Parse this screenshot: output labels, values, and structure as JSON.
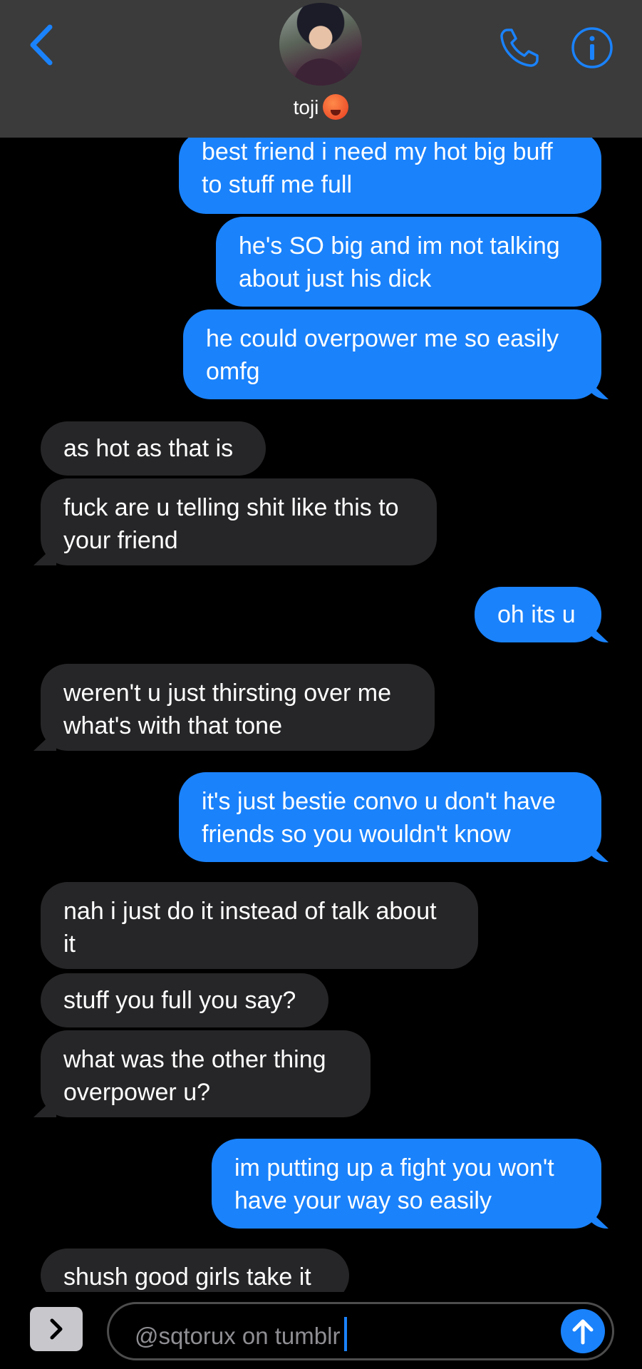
{
  "header": {
    "contact_name": "toji",
    "contact_emoji": "hot-face-emoji",
    "back_icon": "chevron-left-icon",
    "call_icon": "phone-icon",
    "info_icon": "info-icon",
    "accent": "#1a82fb"
  },
  "messages": [
    {
      "from": "me",
      "text": "best friend i need my hot big buff\nto stuff me full"
    },
    {
      "from": "me",
      "text": "he's SO big and im not talking\nabout just his dick"
    },
    {
      "from": "me",
      "text": "he could overpower me so easily\nomfg"
    },
    {
      "from": "them",
      "text": "as hot as that is"
    },
    {
      "from": "them",
      "text": "fuck are u telling shit like this to\nyour friend"
    },
    {
      "from": "me",
      "text": "oh its u"
    },
    {
      "from": "them",
      "text": "weren't u just thirsting over me\nwhat's with that tone"
    },
    {
      "from": "me",
      "text": "it's just bestie convo u don't have\nfriends so you wouldn't know"
    },
    {
      "from": "them",
      "text": "nah i just do it instead of talk about\nit"
    },
    {
      "from": "them",
      "text": "stuff you full you say?"
    },
    {
      "from": "them",
      "text": "what was the other thing\noverpower u?"
    },
    {
      "from": "me",
      "text": "im putting up a fight you won't\nhave your way so easily"
    },
    {
      "from": "them",
      "text": "shush good girls take it"
    }
  ],
  "composer": {
    "apps_icon": "chevron-right-icon",
    "input_value": "@sqtorux on tumblr",
    "send_icon": "arrow-up-icon"
  }
}
